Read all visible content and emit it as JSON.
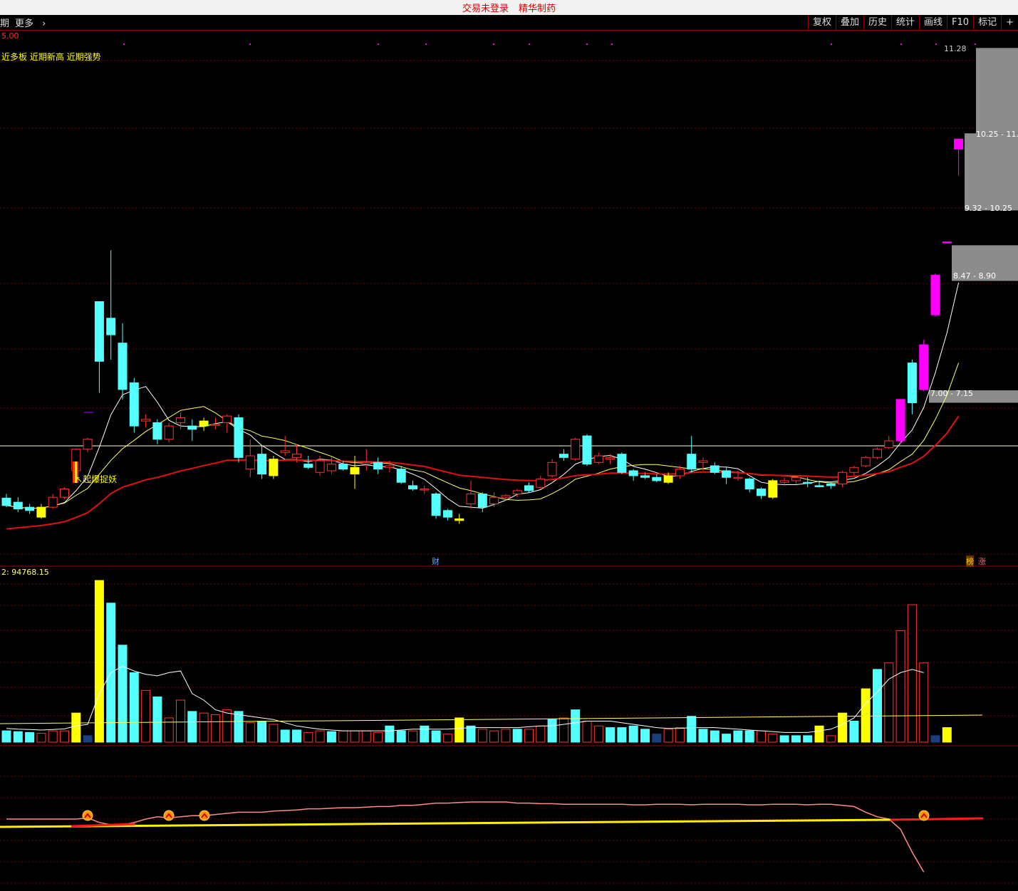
{
  "titlebar": {
    "status": "交易未登录",
    "brand": "精华制药"
  },
  "toolbar": {
    "period_tab": "期",
    "more_label": "更多",
    "buttons": [
      "复权",
      "叠加",
      "历史",
      "统计",
      "画线",
      "F10",
      "标记",
      "+"
    ]
  },
  "colors": {
    "up": "#ff3333",
    "down": "#54ffff",
    "special_up": "#ff00ff",
    "special_hold": "#ffff00",
    "ma_white": "#ffffff",
    "ma_yellow": "#ffff66",
    "ma_red": "#e01010",
    "grid": "#7a0000"
  },
  "price_panel": {
    "top_label": "5.00",
    "indicator_text": "近多板 近期新高 近期强势",
    "signal_label": "起爆捉妖",
    "axis_top": "11.28",
    "zones": [
      "10.25 - 11.",
      "9.32 - 10.25",
      "8.47 - 8.90",
      "7.00 - 7.15"
    ],
    "event_marks": [
      "财",
      "榜",
      "涨"
    ]
  },
  "volume_panel": {
    "label": "2: 94768.15"
  },
  "chart_data": {
    "type": "candlestick",
    "candles": [
      {
        "o": 5.85,
        "h": 5.9,
        "l": 5.74,
        "c": 5.76,
        "t": "d"
      },
      {
        "o": 5.8,
        "h": 5.86,
        "l": 5.68,
        "c": 5.72,
        "t": "d"
      },
      {
        "o": 5.74,
        "h": 5.78,
        "l": 5.66,
        "c": 5.7,
        "t": "d"
      },
      {
        "o": 5.62,
        "h": 5.78,
        "l": 5.6,
        "c": 5.74,
        "t": "y"
      },
      {
        "o": 5.74,
        "h": 5.9,
        "l": 5.72,
        "c": 5.86,
        "t": "u"
      },
      {
        "o": 5.86,
        "h": 5.98,
        "l": 5.84,
        "c": 5.96,
        "t": "u"
      },
      {
        "o": 6.18,
        "h": 6.45,
        "l": 6.14,
        "c": 6.44,
        "t": "u"
      },
      {
        "o": 6.44,
        "h": 6.58,
        "l": 6.4,
        "c": 6.56,
        "t": "u"
      },
      {
        "o": 8.22,
        "h": 8.22,
        "l": 7.12,
        "c": 7.5,
        "t": "d"
      },
      {
        "o": 8.02,
        "h": 8.84,
        "l": 7.52,
        "c": 7.82,
        "t": "d"
      },
      {
        "o": 7.72,
        "h": 7.96,
        "l": 7.04,
        "c": 7.16,
        "t": "d"
      },
      {
        "o": 7.24,
        "h": 7.3,
        "l": 6.64,
        "c": 6.72,
        "t": "d"
      },
      {
        "o": 6.8,
        "h": 6.86,
        "l": 6.7,
        "c": 6.78,
        "t": "u"
      },
      {
        "o": 6.76,
        "h": 6.8,
        "l": 6.5,
        "c": 6.56,
        "t": "d"
      },
      {
        "o": 6.56,
        "h": 6.76,
        "l": 6.52,
        "c": 6.72,
        "t": "u"
      },
      {
        "o": 6.76,
        "h": 6.88,
        "l": 6.68,
        "c": 6.82,
        "t": "u"
      },
      {
        "o": 6.72,
        "h": 6.8,
        "l": 6.54,
        "c": 6.68,
        "t": "d"
      },
      {
        "o": 6.72,
        "h": 6.82,
        "l": 6.66,
        "c": 6.78,
        "t": "y"
      },
      {
        "o": 6.74,
        "h": 6.82,
        "l": 6.68,
        "c": 6.74,
        "t": "u"
      },
      {
        "o": 6.76,
        "h": 6.86,
        "l": 6.64,
        "c": 6.84,
        "t": "u"
      },
      {
        "o": 6.82,
        "h": 6.86,
        "l": 6.28,
        "c": 6.34,
        "t": "d"
      },
      {
        "o": 6.2,
        "h": 6.56,
        "l": 6.1,
        "c": 6.36,
        "t": "u"
      },
      {
        "o": 6.38,
        "h": 6.48,
        "l": 6.08,
        "c": 6.14,
        "t": "d"
      },
      {
        "o": 6.12,
        "h": 6.36,
        "l": 6.08,
        "c": 6.32,
        "t": "y"
      },
      {
        "o": 6.4,
        "h": 6.6,
        "l": 6.36,
        "c": 6.42,
        "t": "u"
      },
      {
        "o": 6.38,
        "h": 6.5,
        "l": 6.28,
        "c": 6.34,
        "t": "u"
      },
      {
        "o": 6.26,
        "h": 6.36,
        "l": 6.2,
        "c": 6.22,
        "t": "d"
      },
      {
        "o": 6.16,
        "h": 6.36,
        "l": 6.12,
        "c": 6.3,
        "t": "u"
      },
      {
        "o": 6.18,
        "h": 6.34,
        "l": 6.14,
        "c": 6.26,
        "t": "u"
      },
      {
        "o": 6.26,
        "h": 6.3,
        "l": 6.18,
        "c": 6.2,
        "t": "d"
      },
      {
        "o": 6.14,
        "h": 6.36,
        "l": 5.96,
        "c": 6.22,
        "t": "y"
      },
      {
        "o": 6.26,
        "h": 6.44,
        "l": 6.18,
        "c": 6.28,
        "t": "u"
      },
      {
        "o": 6.28,
        "h": 6.34,
        "l": 6.14,
        "c": 6.2,
        "t": "d"
      },
      {
        "o": 6.24,
        "h": 6.3,
        "l": 6.16,
        "c": 6.22,
        "t": "u"
      },
      {
        "o": 6.2,
        "h": 6.24,
        "l": 6.02,
        "c": 6.04,
        "t": "d"
      },
      {
        "o": 6.0,
        "h": 6.06,
        "l": 5.94,
        "c": 5.96,
        "t": "d"
      },
      {
        "o": 5.96,
        "h": 6.0,
        "l": 5.9,
        "c": 5.96,
        "t": "u"
      },
      {
        "o": 5.9,
        "h": 5.92,
        "l": 5.6,
        "c": 5.64,
        "t": "d"
      },
      {
        "o": 5.7,
        "h": 5.72,
        "l": 5.58,
        "c": 5.62,
        "t": "d"
      },
      {
        "o": 5.6,
        "h": 5.66,
        "l": 5.54,
        "c": 5.58,
        "t": "y"
      },
      {
        "o": 5.78,
        "h": 6.06,
        "l": 5.72,
        "c": 5.9,
        "t": "u"
      },
      {
        "o": 5.74,
        "h": 5.92,
        "l": 5.68,
        "c": 5.9,
        "t": "d"
      },
      {
        "o": 5.78,
        "h": 5.92,
        "l": 5.74,
        "c": 5.86,
        "t": "u"
      },
      {
        "o": 5.86,
        "h": 5.9,
        "l": 5.82,
        "c": 5.88,
        "t": "u"
      },
      {
        "o": 5.9,
        "h": 5.96,
        "l": 5.86,
        "c": 5.94,
        "t": "u"
      },
      {
        "o": 5.94,
        "h": 6.04,
        "l": 5.92,
        "c": 6.0,
        "t": "d"
      },
      {
        "o": 5.98,
        "h": 6.12,
        "l": 5.96,
        "c": 6.08,
        "t": "u"
      },
      {
        "o": 6.12,
        "h": 6.32,
        "l": 6.1,
        "c": 6.28,
        "t": "u"
      },
      {
        "o": 6.34,
        "h": 6.44,
        "l": 6.3,
        "c": 6.38,
        "t": "d"
      },
      {
        "o": 6.32,
        "h": 6.58,
        "l": 6.3,
        "c": 6.56,
        "t": "u"
      },
      {
        "o": 6.6,
        "h": 6.62,
        "l": 6.24,
        "c": 6.26,
        "t": "d"
      },
      {
        "o": 6.36,
        "h": 6.4,
        "l": 6.26,
        "c": 6.28,
        "t": "u"
      },
      {
        "o": 6.32,
        "h": 6.38,
        "l": 6.26,
        "c": 6.34,
        "t": "u"
      },
      {
        "o": 6.38,
        "h": 6.4,
        "l": 6.14,
        "c": 6.16,
        "t": "d"
      },
      {
        "o": 6.18,
        "h": 6.2,
        "l": 6.06,
        "c": 6.12,
        "t": "d"
      },
      {
        "o": 6.12,
        "h": 6.16,
        "l": 6.08,
        "c": 6.1,
        "t": "d"
      },
      {
        "o": 6.1,
        "h": 6.14,
        "l": 6.04,
        "c": 6.06,
        "t": "d"
      },
      {
        "o": 6.04,
        "h": 6.16,
        "l": 6.02,
        "c": 6.12,
        "t": "y"
      },
      {
        "o": 6.12,
        "h": 6.24,
        "l": 6.08,
        "c": 6.2,
        "t": "u"
      },
      {
        "o": 6.2,
        "h": 6.6,
        "l": 6.16,
        "c": 6.38,
        "t": "d"
      },
      {
        "o": 6.3,
        "h": 6.34,
        "l": 6.18,
        "c": 6.28,
        "t": "u"
      },
      {
        "o": 6.24,
        "h": 6.28,
        "l": 6.14,
        "c": 6.16,
        "t": "d"
      },
      {
        "o": 6.18,
        "h": 6.22,
        "l": 6.02,
        "c": 6.1,
        "t": "d"
      },
      {
        "o": 6.1,
        "h": 6.18,
        "l": 6.06,
        "c": 6.1,
        "t": "u"
      },
      {
        "o": 6.08,
        "h": 6.1,
        "l": 5.92,
        "c": 5.96,
        "t": "d"
      },
      {
        "o": 5.96,
        "h": 5.98,
        "l": 5.84,
        "c": 5.88,
        "t": "d"
      },
      {
        "o": 5.86,
        "h": 6.08,
        "l": 5.84,
        "c": 6.06,
        "t": "y"
      },
      {
        "o": 6.04,
        "h": 6.1,
        "l": 6.0,
        "c": 6.06,
        "t": "u"
      },
      {
        "o": 6.06,
        "h": 6.12,
        "l": 6.02,
        "c": 6.1,
        "t": "u"
      },
      {
        "o": 6.04,
        "h": 6.1,
        "l": 5.98,
        "c": 6.04,
        "t": "d"
      },
      {
        "o": 6.0,
        "h": 6.06,
        "l": 5.98,
        "c": 6.0,
        "t": "d"
      },
      {
        "o": 6.0,
        "h": 6.04,
        "l": 5.96,
        "c": 6.02,
        "t": "d"
      },
      {
        "o": 6.02,
        "h": 6.18,
        "l": 5.98,
        "c": 6.16,
        "t": "u"
      },
      {
        "o": 6.16,
        "h": 6.24,
        "l": 6.12,
        "c": 6.22,
        "t": "u"
      },
      {
        "o": 6.24,
        "h": 6.36,
        "l": 6.22,
        "c": 6.34,
        "t": "u"
      },
      {
        "o": 6.34,
        "h": 6.46,
        "l": 6.32,
        "c": 6.44,
        "t": "u"
      },
      {
        "o": 6.46,
        "h": 6.6,
        "l": 6.44,
        "c": 6.54,
        "t": "u"
      },
      {
        "o": 6.54,
        "h": 7.04,
        "l": 6.5,
        "c": 7.04,
        "t": "m"
      },
      {
        "o": 7.48,
        "h": 7.52,
        "l": 6.86,
        "c": 7.0,
        "t": "d"
      },
      {
        "o": 7.16,
        "h": 7.76,
        "l": 7.14,
        "c": 7.7,
        "t": "m"
      },
      {
        "o": 8.06,
        "h": 8.56,
        "l": 8.04,
        "c": 8.54,
        "t": "m"
      },
      {
        "o": 8.94,
        "h": 8.94,
        "l": 8.94,
        "c": 8.94,
        "t": "m"
      },
      {
        "o": 10.18,
        "h": 10.18,
        "l": 9.74,
        "c": 10.06,
        "t": "m"
      }
    ],
    "volumes": [
      {
        "v": 0.07,
        "t": "d"
      },
      {
        "v": 0.065,
        "t": "d"
      },
      {
        "v": 0.06,
        "t": "d"
      },
      {
        "v": 0.055,
        "t": "u"
      },
      {
        "v": 0.07,
        "t": "u"
      },
      {
        "v": 0.07,
        "t": "u"
      },
      {
        "v": 0.18,
        "t": "y"
      },
      {
        "v": 0.04,
        "t": "n"
      },
      {
        "v": 1.0,
        "t": "y"
      },
      {
        "v": 0.86,
        "t": "d"
      },
      {
        "v": 0.6,
        "t": "d"
      },
      {
        "v": 0.43,
        "t": "d"
      },
      {
        "v": 0.32,
        "t": "u"
      },
      {
        "v": 0.28,
        "t": "d"
      },
      {
        "v": 0.15,
        "t": "u"
      },
      {
        "v": 0.26,
        "t": "u"
      },
      {
        "v": 0.19,
        "t": "d"
      },
      {
        "v": 0.18,
        "t": "u"
      },
      {
        "v": 0.17,
        "t": "u"
      },
      {
        "v": 0.2,
        "t": "u"
      },
      {
        "v": 0.19,
        "t": "d"
      },
      {
        "v": 0.12,
        "t": "u"
      },
      {
        "v": 0.13,
        "t": "d"
      },
      {
        "v": 0.11,
        "t": "u"
      },
      {
        "v": 0.075,
        "t": "d"
      },
      {
        "v": 0.075,
        "t": "d"
      },
      {
        "v": 0.06,
        "t": "u"
      },
      {
        "v": 0.07,
        "t": "u"
      },
      {
        "v": 0.065,
        "t": "d"
      },
      {
        "v": 0.07,
        "t": "u"
      },
      {
        "v": 0.07,
        "t": "u"
      },
      {
        "v": 0.07,
        "t": "u"
      },
      {
        "v": 0.06,
        "t": "u"
      },
      {
        "v": 0.1,
        "t": "d"
      },
      {
        "v": 0.07,
        "t": "d"
      },
      {
        "v": 0.07,
        "t": "u"
      },
      {
        "v": 0.1,
        "t": "d"
      },
      {
        "v": 0.07,
        "t": "d"
      },
      {
        "v": 0.05,
        "t": "u"
      },
      {
        "v": 0.15,
        "t": "y"
      },
      {
        "v": 0.1,
        "t": "d"
      },
      {
        "v": 0.08,
        "t": "u"
      },
      {
        "v": 0.07,
        "t": "u"
      },
      {
        "v": 0.08,
        "t": "u"
      },
      {
        "v": 0.08,
        "t": "d"
      },
      {
        "v": 0.08,
        "t": "u"
      },
      {
        "v": 0.1,
        "t": "u"
      },
      {
        "v": 0.14,
        "t": "d"
      },
      {
        "v": 0.15,
        "t": "u"
      },
      {
        "v": 0.2,
        "t": "d"
      },
      {
        "v": 0.13,
        "t": "u"
      },
      {
        "v": 0.1,
        "t": "u"
      },
      {
        "v": 0.09,
        "t": "d"
      },
      {
        "v": 0.09,
        "t": "d"
      },
      {
        "v": 0.1,
        "t": "d"
      },
      {
        "v": 0.08,
        "t": "d"
      },
      {
        "v": 0.05,
        "t": "n"
      },
      {
        "v": 0.08,
        "t": "u"
      },
      {
        "v": 0.09,
        "t": "u"
      },
      {
        "v": 0.16,
        "t": "d"
      },
      {
        "v": 0.08,
        "t": "d"
      },
      {
        "v": 0.07,
        "t": "d"
      },
      {
        "v": 0.05,
        "t": "d"
      },
      {
        "v": 0.07,
        "t": "d"
      },
      {
        "v": 0.07,
        "t": "d"
      },
      {
        "v": 0.07,
        "t": "u"
      },
      {
        "v": 0.05,
        "t": "u"
      },
      {
        "v": 0.04,
        "t": "d"
      },
      {
        "v": 0.04,
        "t": "d"
      },
      {
        "v": 0.04,
        "t": "d"
      },
      {
        "v": 0.1,
        "t": "y"
      },
      {
        "v": 0.04,
        "t": "u"
      },
      {
        "v": 0.18,
        "t": "y"
      },
      {
        "v": 0.13,
        "t": "d"
      },
      {
        "v": 0.33,
        "t": "y"
      },
      {
        "v": 0.45,
        "t": "d"
      },
      {
        "v": 0.49,
        "t": "u"
      },
      {
        "v": 0.69,
        "t": "u"
      },
      {
        "v": 0.85,
        "t": "u"
      },
      {
        "v": 0.49,
        "t": "u"
      },
      {
        "v": 0.04,
        "t": "n"
      },
      {
        "v": 0.09,
        "t": "y"
      }
    ],
    "volume_ma": [
      0.085,
      0.08,
      0.078,
      0.075,
      0.078,
      0.082,
      0.1,
      0.11,
      0.3,
      0.43,
      0.47,
      0.44,
      0.42,
      0.41,
      0.43,
      0.44,
      0.3,
      0.26,
      0.2,
      0.18,
      0.17,
      0.16,
      0.15,
      0.14,
      0.12,
      0.1,
      0.09,
      0.08,
      0.075,
      0.07,
      0.07,
      0.07,
      0.07,
      0.07,
      0.075,
      0.08,
      0.08,
      0.08,
      0.08,
      0.085,
      0.09,
      0.09,
      0.09,
      0.09,
      0.09,
      0.095,
      0.1,
      0.1,
      0.11,
      0.12,
      0.13,
      0.13,
      0.13,
      0.12,
      0.11,
      0.1,
      0.09,
      0.085,
      0.085,
      0.09,
      0.09,
      0.09,
      0.085,
      0.08,
      0.075,
      0.07,
      0.065,
      0.06,
      0.06,
      0.06,
      0.07,
      0.08,
      0.11,
      0.15,
      0.24,
      0.31,
      0.39,
      0.43,
      0.45,
      0.43
    ],
    "osc_pink": [
      0.42,
      0.42,
      0.42,
      0.42,
      0.42,
      0.42,
      0.42,
      0.4,
      0.48,
      0.52,
      0.52,
      0.48,
      0.42,
      0.38,
      0.4,
      0.38,
      0.36,
      0.36,
      0.34,
      0.32,
      0.3,
      0.3,
      0.3,
      0.28,
      0.27,
      0.26,
      0.24,
      0.24,
      0.23,
      0.22,
      0.22,
      0.21,
      0.2,
      0.2,
      0.18,
      0.18,
      0.16,
      0.14,
      0.14,
      0.13,
      0.12,
      0.12,
      0.12,
      0.12,
      0.14,
      0.14,
      0.15,
      0.15,
      0.16,
      0.16,
      0.16,
      0.16,
      0.16,
      0.16,
      0.17,
      0.17,
      0.16,
      0.16,
      0.16,
      0.17,
      0.16,
      0.16,
      0.16,
      0.16,
      0.17,
      0.17,
      0.16,
      0.16,
      0.16,
      0.17,
      0.16,
      0.16,
      0.18,
      0.2,
      0.3,
      0.38,
      0.42,
      0.6,
      1.0,
      1.35
    ],
    "osc_yellow": 0.42,
    "osc_red_start": 0.42,
    "zone_values": [
      [
        10.25,
        11.28
      ],
      [
        9.32,
        10.25
      ],
      [
        8.47,
        8.9
      ],
      [
        7.0,
        7.15
      ]
    ],
    "price_range": [
      5.2,
      11.3
    ],
    "reference_price": 6.48
  }
}
